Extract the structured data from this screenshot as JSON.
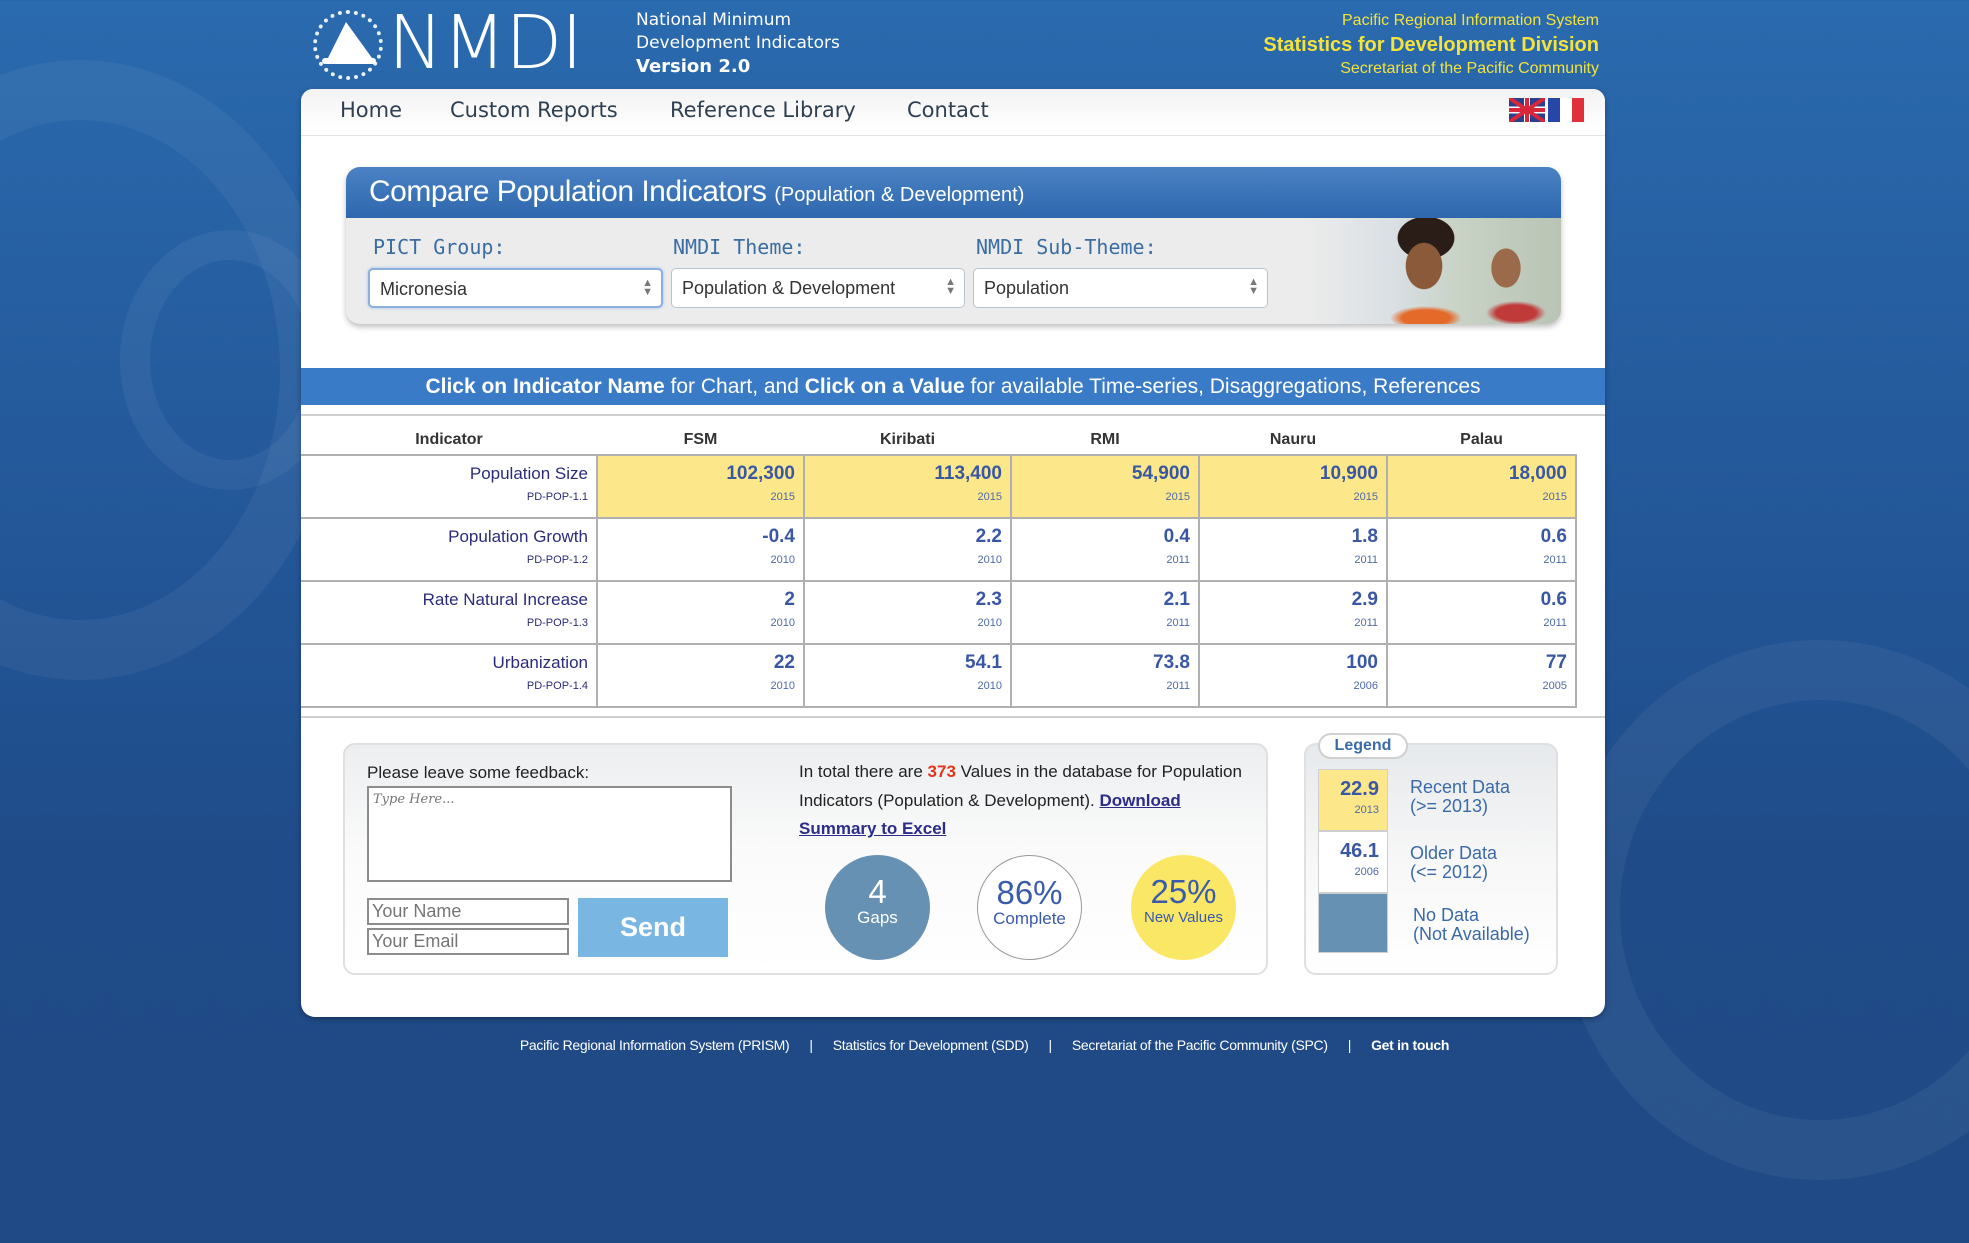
{
  "header": {
    "logo_text": "NMDI",
    "subtitle_line1": "National Minimum",
    "subtitle_line2": "Development Indicators",
    "version": "Version 2.0",
    "org_line1": "Pacific Regional Information System",
    "org_line2": "Statistics for Development Division",
    "org_line3": "Secretariat of the Pacific Community"
  },
  "nav": {
    "items": [
      {
        "label": "Home"
      },
      {
        "label": "Custom Reports"
      },
      {
        "label": "Reference Library"
      },
      {
        "label": "Contact"
      }
    ],
    "languages": [
      "English",
      "French"
    ]
  },
  "compare": {
    "title": "Compare Population Indicators",
    "subtitle": "(Population & Development)",
    "filters": [
      {
        "label": "PICT Group:",
        "value": "Micronesia"
      },
      {
        "label": "NMDI Theme:",
        "value": "Population & Development"
      },
      {
        "label": "NMDI Sub-Theme:",
        "value": "Population"
      }
    ]
  },
  "instruction": {
    "bold1": "Click on Indicator Name",
    "text1": " for Chart, and ",
    "bold2": "Click on a Value",
    "text2": " for available Time-series, Disaggregations, References"
  },
  "table": {
    "headers": [
      "Indicator",
      "FSM",
      "Kiribati",
      "RMI",
      "Nauru",
      "Palau"
    ],
    "rows": [
      {
        "name": "Population Size",
        "code": "PD-POP-1.1",
        "cells": [
          {
            "value": "102,300",
            "year": "2015",
            "recent": true
          },
          {
            "value": "113,400",
            "year": "2015",
            "recent": true
          },
          {
            "value": "54,900",
            "year": "2015",
            "recent": true
          },
          {
            "value": "10,900",
            "year": "2015",
            "recent": true
          },
          {
            "value": "18,000",
            "year": "2015",
            "recent": true
          }
        ]
      },
      {
        "name": "Population Growth",
        "code": "PD-POP-1.2",
        "cells": [
          {
            "value": "-0.4",
            "year": "2010",
            "recent": false
          },
          {
            "value": "2.2",
            "year": "2010",
            "recent": false
          },
          {
            "value": "0.4",
            "year": "2011",
            "recent": false
          },
          {
            "value": "1.8",
            "year": "2011",
            "recent": false
          },
          {
            "value": "0.6",
            "year": "2011",
            "recent": false
          }
        ]
      },
      {
        "name": "Rate Natural Increase",
        "code": "PD-POP-1.3",
        "cells": [
          {
            "value": "2",
            "year": "2010",
            "recent": false
          },
          {
            "value": "2.3",
            "year": "2010",
            "recent": false
          },
          {
            "value": "2.1",
            "year": "2011",
            "recent": false
          },
          {
            "value": "2.9",
            "year": "2011",
            "recent": false
          },
          {
            "value": "0.6",
            "year": "2011",
            "recent": false
          }
        ]
      },
      {
        "name": "Urbanization",
        "code": "PD-POP-1.4",
        "cells": [
          {
            "value": "22",
            "year": "2010",
            "recent": false
          },
          {
            "value": "54.1",
            "year": "2010",
            "recent": false
          },
          {
            "value": "73.8",
            "year": "2011",
            "recent": false
          },
          {
            "value": "100",
            "year": "2006",
            "recent": false
          },
          {
            "value": "77",
            "year": "2005",
            "recent": false
          }
        ]
      }
    ]
  },
  "feedback": {
    "label": "Please leave some feedback:",
    "textarea_placeholder": "Type Here...",
    "name_placeholder": "Your Name",
    "email_placeholder": "Your Email",
    "send_label": "Send"
  },
  "summary": {
    "prefix": "In total there are ",
    "count": "373",
    "middle": " Values in the database for Population Indicators (Population & Development). ",
    "link": "Download Summary to Excel"
  },
  "stats": [
    {
      "big": "4",
      "small": "Gaps"
    },
    {
      "big": "86%",
      "small": "Complete"
    },
    {
      "big": "25%",
      "small": "New Values"
    }
  ],
  "legend": {
    "title": "Legend",
    "items": [
      {
        "value": "22.9",
        "year": "2013",
        "label1": "Recent Data",
        "label2": "(>= 2013)"
      },
      {
        "value": "46.1",
        "year": "2006",
        "label1": "Older Data",
        "label2": "(<= 2012)"
      },
      {
        "value": "",
        "year": "",
        "label1": "No Data",
        "label2": "(Not Available)"
      }
    ],
    "colors": {
      "recent": "#fce88a",
      "older": "#ffffff",
      "none": "#6791b3"
    }
  },
  "footer": {
    "links": [
      "Pacific Regional Information System (PRISM)",
      "Statistics for Development (SDD)",
      "Secretariat of the Pacific Community (SPC)",
      "Get in touch"
    ]
  }
}
